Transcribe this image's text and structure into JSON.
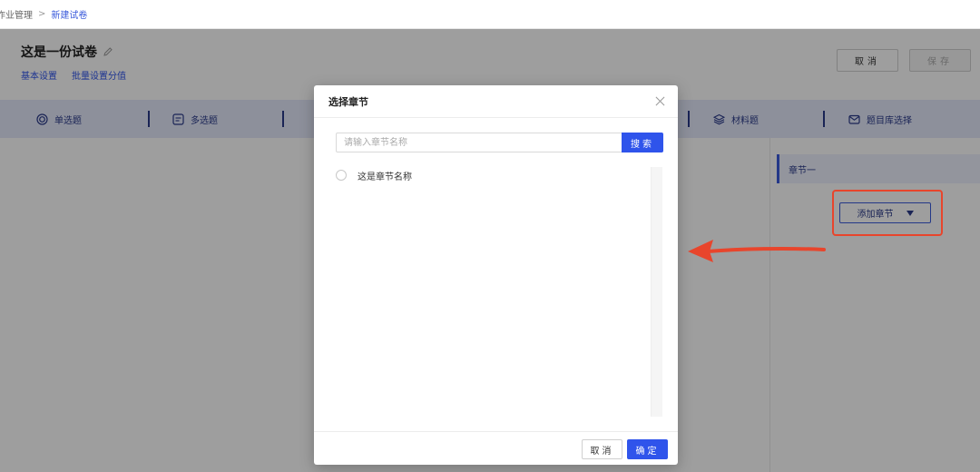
{
  "breadcrumb": {
    "parent": "作业管理",
    "separator": ">",
    "current": "新建试卷"
  },
  "header": {
    "title": "这是一份试卷",
    "subnav": [
      "基本设置",
      "批量设置分值"
    ],
    "cancel_label": "取消",
    "save_label": "保存"
  },
  "toolbar": {
    "items": [
      {
        "label": "单选题",
        "icon": "radio-circle-icon"
      },
      {
        "label": "多选题",
        "icon": "checklist-icon"
      },
      {
        "label": "材料题",
        "icon": "layers-icon"
      },
      {
        "label": "题目库选择",
        "icon": "envelope-icon"
      }
    ]
  },
  "right_panel": {
    "chapter_tab": "章节一",
    "add_chapter_label": "添加章节"
  },
  "modal": {
    "title": "选择章节",
    "search_placeholder": "请输入章节名称",
    "search_label": "搜索",
    "items": [
      {
        "label": "这是章节名称",
        "selected": false
      }
    ],
    "cancel_label": "取消",
    "confirm_label": "确定"
  },
  "colors": {
    "accent": "#2f54eb",
    "toolbar_bg": "#e4e9fb",
    "annotation_red": "#e8452c"
  }
}
